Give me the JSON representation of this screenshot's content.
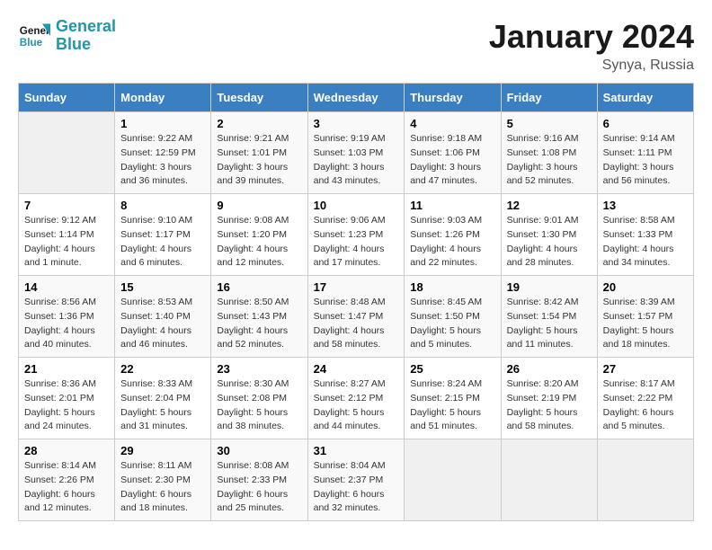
{
  "header": {
    "logo_line1": "General",
    "logo_line2": "Blue",
    "month": "January 2024",
    "location": "Synya, Russia"
  },
  "weekdays": [
    "Sunday",
    "Monday",
    "Tuesday",
    "Wednesday",
    "Thursday",
    "Friday",
    "Saturday"
  ],
  "weeks": [
    [
      {
        "day": "",
        "sunrise": "",
        "sunset": "",
        "daylight": ""
      },
      {
        "day": "1",
        "sunrise": "9:22 AM",
        "sunset": "12:59 PM",
        "daylight": "3 hours and 36 minutes."
      },
      {
        "day": "2",
        "sunrise": "9:21 AM",
        "sunset": "1:01 PM",
        "daylight": "3 hours and 39 minutes."
      },
      {
        "day": "3",
        "sunrise": "9:19 AM",
        "sunset": "1:03 PM",
        "daylight": "3 hours and 43 minutes."
      },
      {
        "day": "4",
        "sunrise": "9:18 AM",
        "sunset": "1:06 PM",
        "daylight": "3 hours and 47 minutes."
      },
      {
        "day": "5",
        "sunrise": "9:16 AM",
        "sunset": "1:08 PM",
        "daylight": "3 hours and 52 minutes."
      },
      {
        "day": "6",
        "sunrise": "9:14 AM",
        "sunset": "1:11 PM",
        "daylight": "3 hours and 56 minutes."
      }
    ],
    [
      {
        "day": "7",
        "sunrise": "9:12 AM",
        "sunset": "1:14 PM",
        "daylight": "4 hours and 1 minute."
      },
      {
        "day": "8",
        "sunrise": "9:10 AM",
        "sunset": "1:17 PM",
        "daylight": "4 hours and 6 minutes."
      },
      {
        "day": "9",
        "sunrise": "9:08 AM",
        "sunset": "1:20 PM",
        "daylight": "4 hours and 12 minutes."
      },
      {
        "day": "10",
        "sunrise": "9:06 AM",
        "sunset": "1:23 PM",
        "daylight": "4 hours and 17 minutes."
      },
      {
        "day": "11",
        "sunrise": "9:03 AM",
        "sunset": "1:26 PM",
        "daylight": "4 hours and 22 minutes."
      },
      {
        "day": "12",
        "sunrise": "9:01 AM",
        "sunset": "1:30 PM",
        "daylight": "4 hours and 28 minutes."
      },
      {
        "day": "13",
        "sunrise": "8:58 AM",
        "sunset": "1:33 PM",
        "daylight": "4 hours and 34 minutes."
      }
    ],
    [
      {
        "day": "14",
        "sunrise": "8:56 AM",
        "sunset": "1:36 PM",
        "daylight": "4 hours and 40 minutes."
      },
      {
        "day": "15",
        "sunrise": "8:53 AM",
        "sunset": "1:40 PM",
        "daylight": "4 hours and 46 minutes."
      },
      {
        "day": "16",
        "sunrise": "8:50 AM",
        "sunset": "1:43 PM",
        "daylight": "4 hours and 52 minutes."
      },
      {
        "day": "17",
        "sunrise": "8:48 AM",
        "sunset": "1:47 PM",
        "daylight": "4 hours and 58 minutes."
      },
      {
        "day": "18",
        "sunrise": "8:45 AM",
        "sunset": "1:50 PM",
        "daylight": "5 hours and 5 minutes."
      },
      {
        "day": "19",
        "sunrise": "8:42 AM",
        "sunset": "1:54 PM",
        "daylight": "5 hours and 11 minutes."
      },
      {
        "day": "20",
        "sunrise": "8:39 AM",
        "sunset": "1:57 PM",
        "daylight": "5 hours and 18 minutes."
      }
    ],
    [
      {
        "day": "21",
        "sunrise": "8:36 AM",
        "sunset": "2:01 PM",
        "daylight": "5 hours and 24 minutes."
      },
      {
        "day": "22",
        "sunrise": "8:33 AM",
        "sunset": "2:04 PM",
        "daylight": "5 hours and 31 minutes."
      },
      {
        "day": "23",
        "sunrise": "8:30 AM",
        "sunset": "2:08 PM",
        "daylight": "5 hours and 38 minutes."
      },
      {
        "day": "24",
        "sunrise": "8:27 AM",
        "sunset": "2:12 PM",
        "daylight": "5 hours and 44 minutes."
      },
      {
        "day": "25",
        "sunrise": "8:24 AM",
        "sunset": "2:15 PM",
        "daylight": "5 hours and 51 minutes."
      },
      {
        "day": "26",
        "sunrise": "8:20 AM",
        "sunset": "2:19 PM",
        "daylight": "5 hours and 58 minutes."
      },
      {
        "day": "27",
        "sunrise": "8:17 AM",
        "sunset": "2:22 PM",
        "daylight": "6 hours and 5 minutes."
      }
    ],
    [
      {
        "day": "28",
        "sunrise": "8:14 AM",
        "sunset": "2:26 PM",
        "daylight": "6 hours and 12 minutes."
      },
      {
        "day": "29",
        "sunrise": "8:11 AM",
        "sunset": "2:30 PM",
        "daylight": "6 hours and 18 minutes."
      },
      {
        "day": "30",
        "sunrise": "8:08 AM",
        "sunset": "2:33 PM",
        "daylight": "6 hours and 25 minutes."
      },
      {
        "day": "31",
        "sunrise": "8:04 AM",
        "sunset": "2:37 PM",
        "daylight": "6 hours and 32 minutes."
      },
      {
        "day": "",
        "sunrise": "",
        "sunset": "",
        "daylight": ""
      },
      {
        "day": "",
        "sunrise": "",
        "sunset": "",
        "daylight": ""
      },
      {
        "day": "",
        "sunrise": "",
        "sunset": "",
        "daylight": ""
      }
    ]
  ],
  "labels": {
    "sunrise_prefix": "Sunrise: ",
    "sunset_prefix": "Sunset: ",
    "daylight_prefix": "Daylight: "
  }
}
